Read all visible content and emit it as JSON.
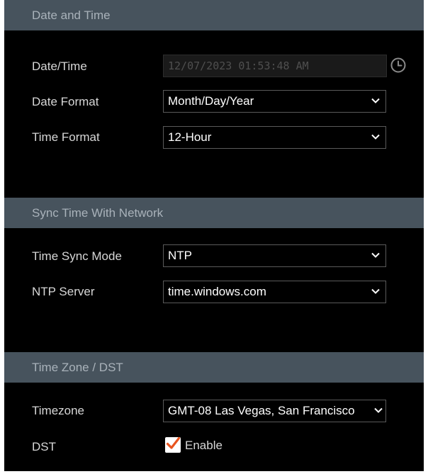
{
  "date_time_section": {
    "title": "Date and Time",
    "date_time": {
      "label": "Date/Time",
      "value": "12/07/2023 01:53:48 AM",
      "icon": "clock-icon"
    },
    "date_format": {
      "label": "Date Format",
      "value": "Month/Day/Year"
    },
    "time_format": {
      "label": "Time Format",
      "value": "12-Hour"
    }
  },
  "sync_section": {
    "title": "Sync Time With Network",
    "sync_mode": {
      "label": "Time Sync Mode",
      "value": "NTP"
    },
    "ntp_server": {
      "label": "NTP Server",
      "value": "time.windows.com"
    }
  },
  "timezone_section": {
    "title": "Time Zone / DST",
    "timezone": {
      "label": "Timezone",
      "value": "GMT-08 Las Vegas, San Francisco"
    },
    "dst": {
      "label": "DST",
      "checkbox_label": "Enable",
      "checked": true
    }
  },
  "colors": {
    "header_bg": "#47535d",
    "panel_bg": "#000000",
    "checkbox_accent": "#e8541f"
  }
}
